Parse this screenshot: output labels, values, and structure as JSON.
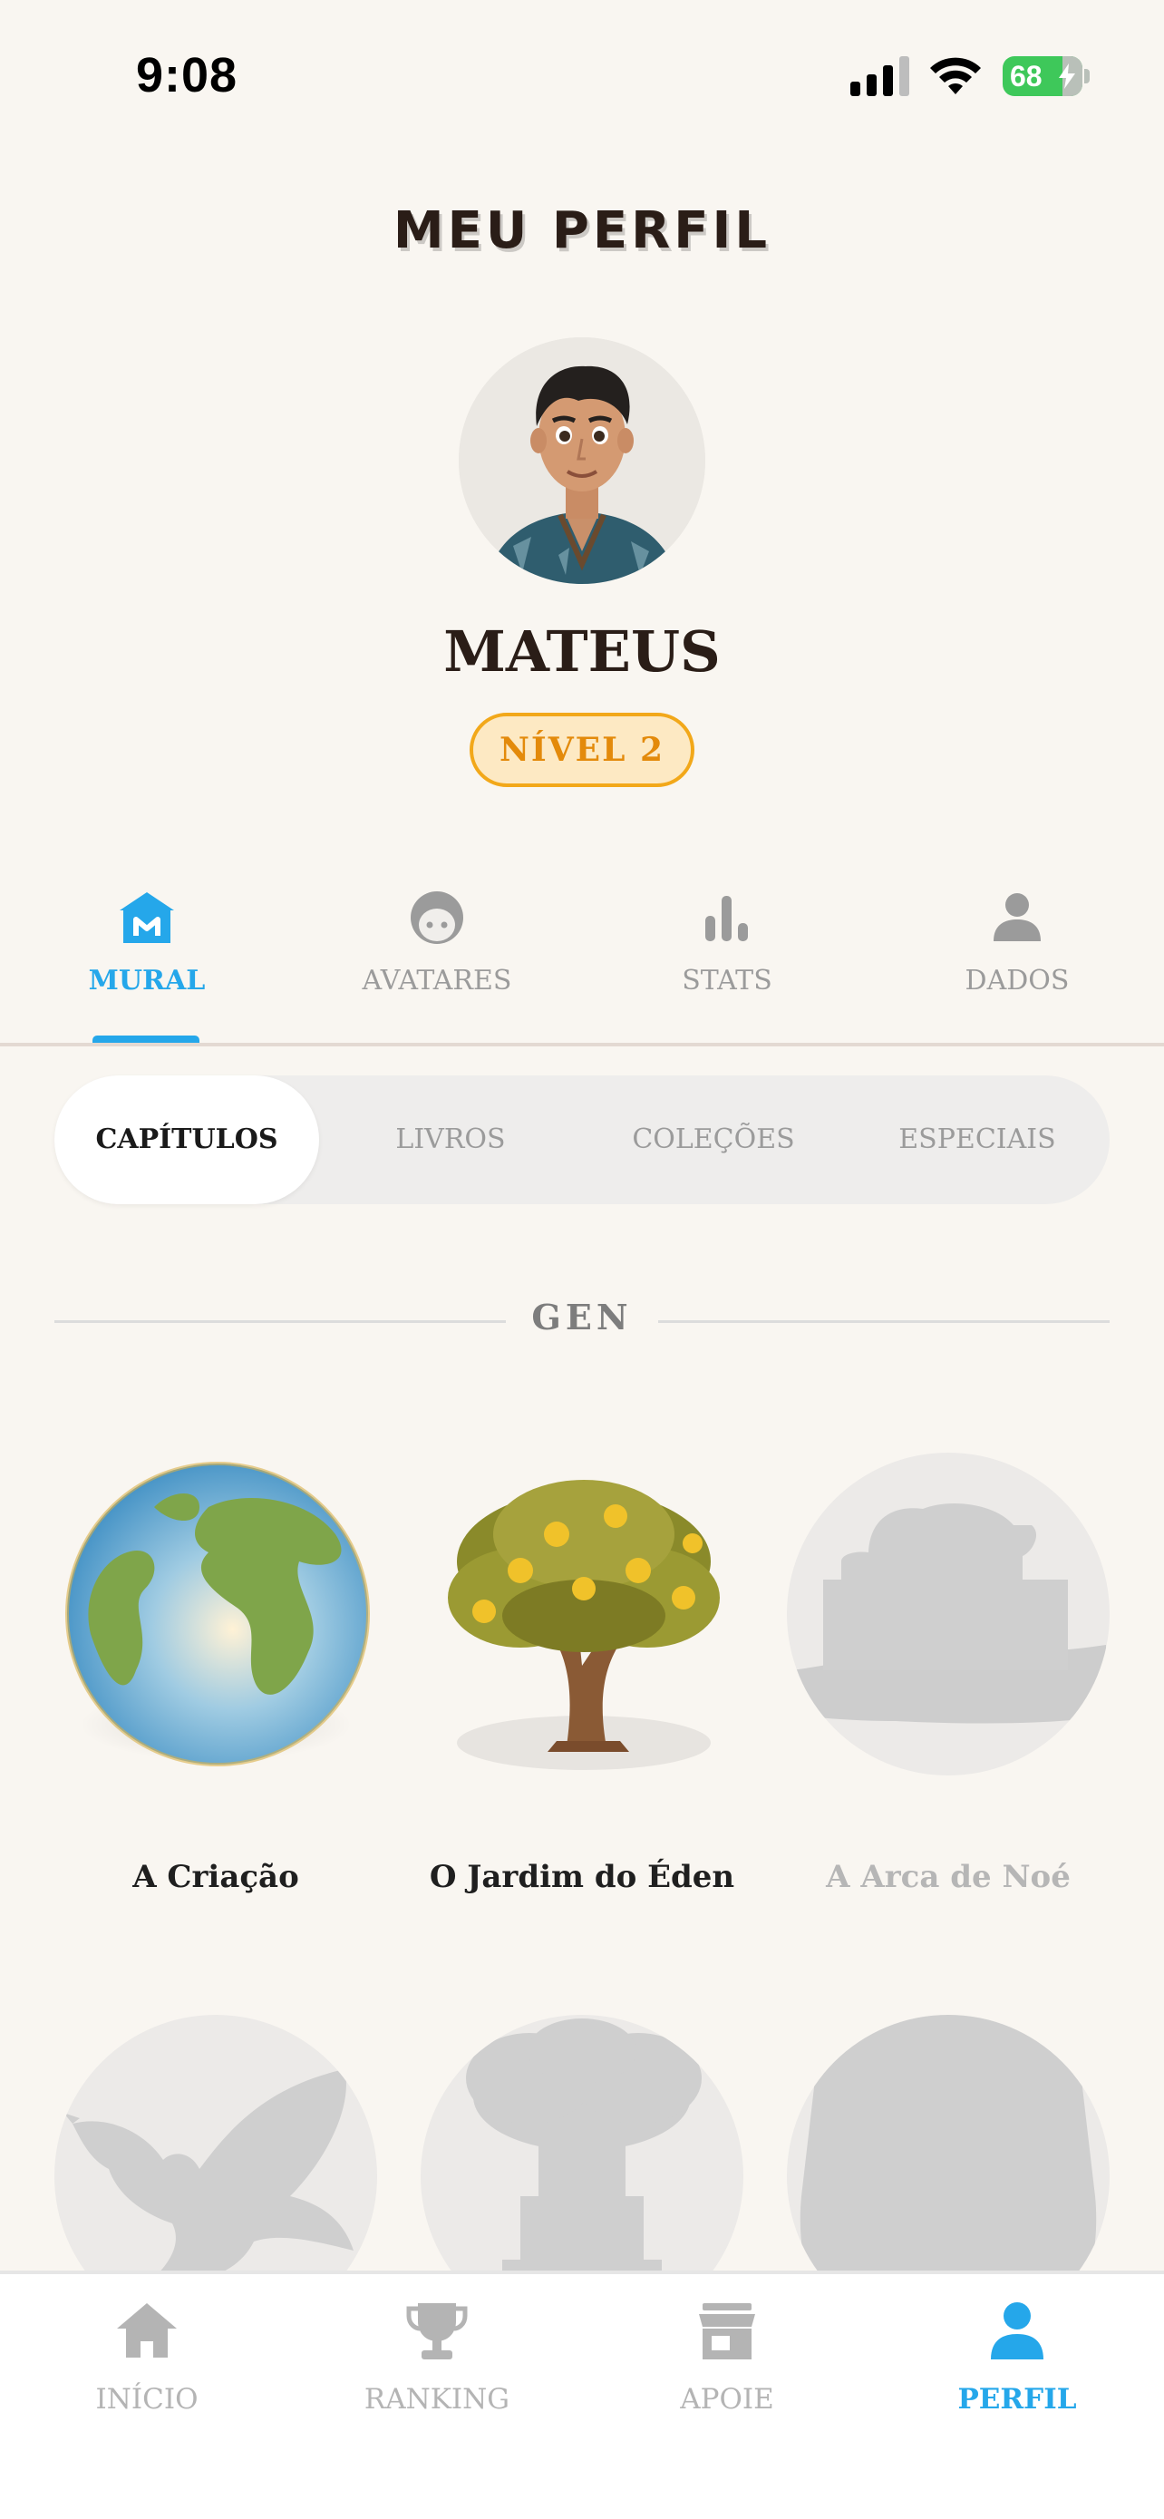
{
  "status_bar": {
    "time": "9:08",
    "battery": "68"
  },
  "header": {
    "title": "MEU PERFIL"
  },
  "profile": {
    "name": "MATEUS",
    "level": "NÍVEL 2"
  },
  "profile_tabs": [
    {
      "label": "MURAL",
      "icon": "mural-house-icon",
      "active": true
    },
    {
      "label": "AVATARES",
      "icon": "face-icon",
      "active": false
    },
    {
      "label": "STATS",
      "icon": "bar-chart-icon",
      "active": false
    },
    {
      "label": "DADOS",
      "icon": "person-icon",
      "active": false
    }
  ],
  "segments": [
    {
      "label": "CAPÍTULOS",
      "active": true
    },
    {
      "label": "LIVROS",
      "active": false
    },
    {
      "label": "COLEÇÕES",
      "active": false
    },
    {
      "label": "ESPECIAIS",
      "active": false
    }
  ],
  "section": {
    "title": "GEN"
  },
  "chapters": [
    {
      "name": "A Criação",
      "icon": "earth-globe-icon",
      "locked": false
    },
    {
      "name": "O Jardim do Éden",
      "icon": "golden-fruit-tree-icon",
      "locked": false
    },
    {
      "name": "A Arca de Noé",
      "icon": "ark-silhouette-icon",
      "locked": true
    },
    {
      "name": "",
      "icon": "dove-silhouette-icon",
      "locked": true
    },
    {
      "name": "",
      "icon": "tower-silhouette-icon",
      "locked": true
    },
    {
      "name": "",
      "icon": "scroll-silhouette-icon",
      "locked": true
    }
  ],
  "bottom_nav": [
    {
      "label": "INÍCIO",
      "icon": "home-icon",
      "active": false
    },
    {
      "label": "RANKING",
      "icon": "trophy-icon",
      "active": false
    },
    {
      "label": "APOIE",
      "icon": "store-icon",
      "active": false
    },
    {
      "label": "PERFIL",
      "icon": "person-icon",
      "active": true
    }
  ],
  "colors": {
    "accent": "#25a7ea",
    "level": "#e38a0b",
    "background": "#f9f6f1"
  }
}
